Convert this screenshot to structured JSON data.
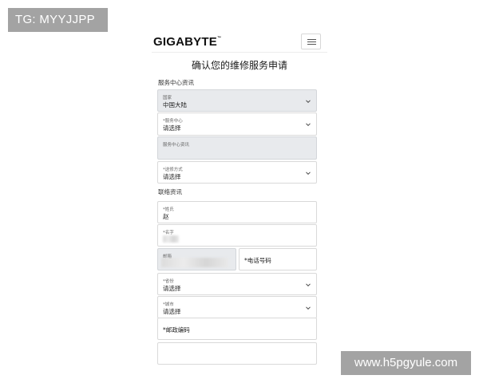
{
  "watermarks": {
    "top": "TG: MYYJJPP",
    "bottom": "www.h5pgyule.com"
  },
  "header": {
    "logo": "GIGABYTE",
    "logo_tm": "™",
    "menu_icon": "hamburger-icon"
  },
  "page_title": "确认您的维修服务申请",
  "sections": {
    "service_center": "服务中心资讯",
    "contact": "联络资讯"
  },
  "fields": {
    "country": {
      "label": "国家",
      "value": "中国大陆"
    },
    "service_center": {
      "label": "*服务中心",
      "value": "请选择"
    },
    "service_center_info": {
      "label": "服务中心资讯"
    },
    "delivery": {
      "label": "*送修方式",
      "value": "请选择"
    },
    "surname": {
      "label": "*姓氏",
      "value": "赵"
    },
    "given_name": {
      "label": "*名字"
    },
    "email": {
      "label": "邮箱"
    },
    "phone": {
      "label": "*电话号码"
    },
    "province": {
      "label": "*省份",
      "value": "请选择"
    },
    "city": {
      "label": "*城市",
      "value": "请选择"
    },
    "postal_code": {
      "label": "*邮政编码"
    }
  },
  "colors": {
    "watermark_bg": "#a3a3a3",
    "grey_field": "#e8eaed",
    "border": "#d9d9d9"
  }
}
